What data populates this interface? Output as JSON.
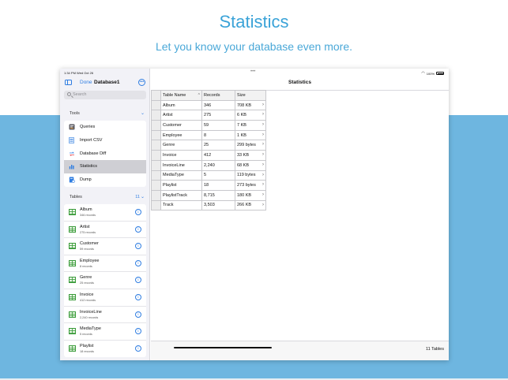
{
  "hero": {
    "title": "Statistics",
    "subtitle": "Let you know your database even more."
  },
  "status_bar": {
    "time": "1:34 PM  Wed Oct 26",
    "battery": "100%"
  },
  "sidebar": {
    "done_label": "Done",
    "database_name": "Database1",
    "search_placeholder": "Search",
    "tools_header": "Tools",
    "tools": [
      {
        "label": "Queries",
        "icon": "queries-icon"
      },
      {
        "label": "Import CSV",
        "icon": "import-csv-icon"
      },
      {
        "label": "Database Diff",
        "icon": "database-diff-icon"
      },
      {
        "label": "Statistics",
        "icon": "statistics-icon",
        "selected": true
      },
      {
        "label": "Dump",
        "icon": "dump-icon"
      }
    ],
    "tables_header": "Tables",
    "tables_count": "11",
    "tables": [
      {
        "name": "Album",
        "records": "346 records"
      },
      {
        "name": "Artist",
        "records": "275 records"
      },
      {
        "name": "Customer",
        "records": "59 records"
      },
      {
        "name": "Employee",
        "records": "8 records"
      },
      {
        "name": "Genre",
        "records": "25 records"
      },
      {
        "name": "Invoice",
        "records": "412 records"
      },
      {
        "name": "InvoiceLine",
        "records": "2,240 records"
      },
      {
        "name": "MediaType",
        "records": "5 records"
      },
      {
        "name": "Playlist",
        "records": "18 records"
      }
    ]
  },
  "main": {
    "title": "Statistics",
    "columns": [
      "Table Name",
      "Records",
      "Size"
    ],
    "rows": [
      {
        "name": "Album",
        "records": "346",
        "size": "708 KB"
      },
      {
        "name": "Artist",
        "records": "275",
        "size": "6 KB"
      },
      {
        "name": "Customer",
        "records": "59",
        "size": "7 KB"
      },
      {
        "name": "Employee",
        "records": "8",
        "size": "1 KB"
      },
      {
        "name": "Genre",
        "records": "25",
        "size": "299 bytes"
      },
      {
        "name": "Invoice",
        "records": "412",
        "size": "33 KB"
      },
      {
        "name": "InvoiceLine",
        "records": "2,240",
        "size": "68 KB"
      },
      {
        "name": "MediaType",
        "records": "5",
        "size": "119 bytes"
      },
      {
        "name": "Playlist",
        "records": "18",
        "size": "273 bytes"
      },
      {
        "name": "PlaylistTrack",
        "records": "8,715",
        "size": "180 KB"
      },
      {
        "name": "Track",
        "records": "3,503",
        "size": "266 KB"
      }
    ],
    "footer": "11 Tables"
  },
  "colors": {
    "accent": "#2f7de1",
    "hero_text": "#3ba3d8",
    "band": "#6eb6e0",
    "table_icon": "#3a9b3a"
  }
}
